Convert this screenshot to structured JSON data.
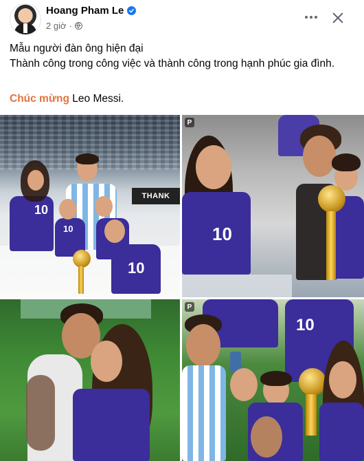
{
  "post": {
    "author": "Hoang Pham Le",
    "verified_icon": "verified-badge-icon",
    "time": "2 giờ",
    "audience_icon": "globe-icon",
    "text_lines": [
      "Mẫu người đàn ông hiện đại",
      "Thành công trong công việc và thành công trong hạnh phúc gia đình."
    ],
    "congrats_highlight": "Chúc mừng",
    "congrats_rest": " Leo Messi."
  },
  "photos": [
    {
      "banner": "THANK",
      "jersey_numbers": [
        "10",
        "10",
        "10"
      ]
    },
    {
      "badge": "P",
      "jersey_numbers": [
        "10"
      ]
    },
    {
      "jersey_numbers": []
    },
    {
      "badge": "P",
      "jersey_numbers": [
        "10"
      ]
    }
  ],
  "colors": {
    "accent_blue": "#1877f2",
    "congrats_orange": "#e4723c",
    "meta_gray": "#65676b"
  }
}
